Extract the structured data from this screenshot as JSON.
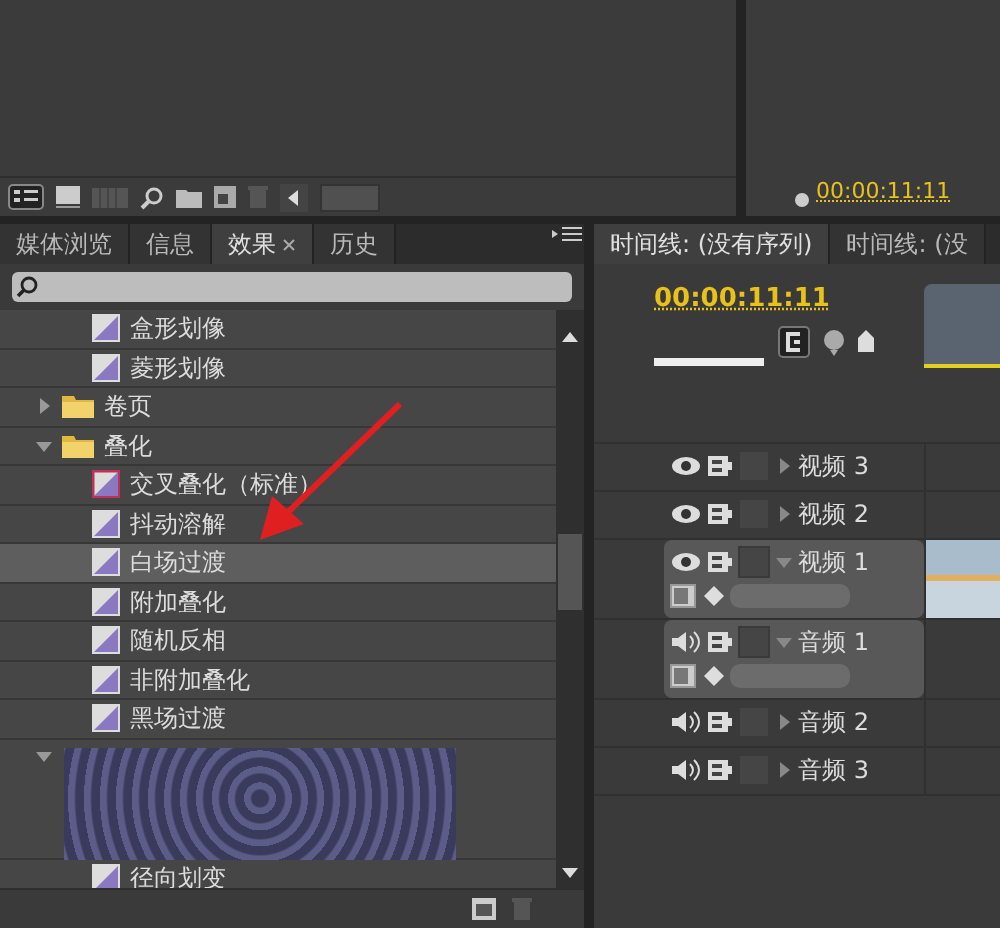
{
  "monitor": {
    "timecode": "00:00:11:11"
  },
  "effects_panel": {
    "tabs": [
      {
        "label": "媒体浏览",
        "selected": false,
        "closable": false
      },
      {
        "label": "信息",
        "selected": false,
        "closable": false
      },
      {
        "label": "效果",
        "selected": true,
        "closable": true
      },
      {
        "label": "历史",
        "selected": false,
        "closable": false
      }
    ],
    "tree": [
      {
        "kind": "effect",
        "label": "盒形划像",
        "selected": false,
        "default": false
      },
      {
        "kind": "effect",
        "label": "菱形划像",
        "selected": false,
        "default": false
      },
      {
        "kind": "folder",
        "label": "卷页",
        "expanded": false
      },
      {
        "kind": "folder",
        "label": "叠化",
        "expanded": true,
        "children": [
          {
            "kind": "effect",
            "label": "交叉叠化（标准）",
            "selected": false,
            "default": true
          },
          {
            "kind": "effect",
            "label": "抖动溶解",
            "selected": false,
            "default": false
          },
          {
            "kind": "effect",
            "label": "白场过渡",
            "selected": true,
            "default": false
          },
          {
            "kind": "effect",
            "label": "附加叠化",
            "selected": false,
            "default": false
          },
          {
            "kind": "effect",
            "label": "随机反相",
            "selected": false,
            "default": false
          },
          {
            "kind": "effect",
            "label": "非附加叠化",
            "selected": false,
            "default": false
          },
          {
            "kind": "effect",
            "label": "黑场过渡",
            "selected": false,
            "default": false
          }
        ]
      },
      {
        "kind": "preview",
        "expanded": true,
        "children": [
          {
            "kind": "effect",
            "label": "径向划变",
            "selected": false,
            "default": false
          }
        ]
      }
    ]
  },
  "timeline_panel": {
    "tabs": [
      {
        "label": "时间线: (没有序列)",
        "selected": true
      },
      {
        "label": "时间线: (没",
        "selected": false
      }
    ],
    "timecode": "00:00:11:11",
    "tracks": [
      {
        "kind": "video",
        "name": "视频 3",
        "expanded": false
      },
      {
        "kind": "video",
        "name": "视频 2",
        "expanded": false
      },
      {
        "kind": "video",
        "name": "视频 1",
        "expanded": true
      },
      {
        "kind": "audio",
        "name": "音频 1",
        "expanded": true
      },
      {
        "kind": "audio",
        "name": "音频 2",
        "expanded": false
      },
      {
        "kind": "audio",
        "name": "音频 3",
        "expanded": false
      }
    ]
  }
}
